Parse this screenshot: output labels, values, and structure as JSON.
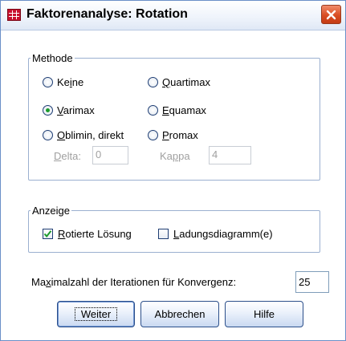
{
  "window": {
    "title": "Faktorenanalyse: Rotation"
  },
  "methode": {
    "legend": "Methode",
    "options": [
      {
        "pre": "Ke",
        "ul": "i",
        "post": "ne",
        "checked": false
      },
      {
        "pre": "",
        "ul": "V",
        "post": "arimax",
        "checked": true
      },
      {
        "pre": "",
        "ul": "O",
        "post": "blimin, direkt",
        "checked": false
      },
      {
        "pre": "",
        "ul": "Q",
        "post": "uartimax",
        "checked": false
      },
      {
        "pre": "",
        "ul": "E",
        "post": "quamax",
        "checked": false
      },
      {
        "pre": "",
        "ul": "P",
        "post": "romax",
        "checked": false
      }
    ],
    "delta": {
      "pre": "",
      "ul": "D",
      "post": "elta:",
      "value": "0"
    },
    "kappa": {
      "pre": "Ka",
      "ul": "p",
      "post": "pa",
      "value": "4"
    }
  },
  "anzeige": {
    "legend": "Anzeige",
    "rotated": {
      "pre": "",
      "ul": "R",
      "post": "otierte Lösung",
      "checked": true
    },
    "loading": {
      "pre": "",
      "ul": "L",
      "post": "adungsdiagramm(e)",
      "checked": false
    }
  },
  "iterations": {
    "pre": "Ma",
    "ul": "x",
    "post": "imalzahl der Iterationen für Konvergenz:",
    "value": "25"
  },
  "buttons": {
    "continue": "Weiter",
    "cancel": "Abbrechen",
    "help": "Hilfe"
  }
}
